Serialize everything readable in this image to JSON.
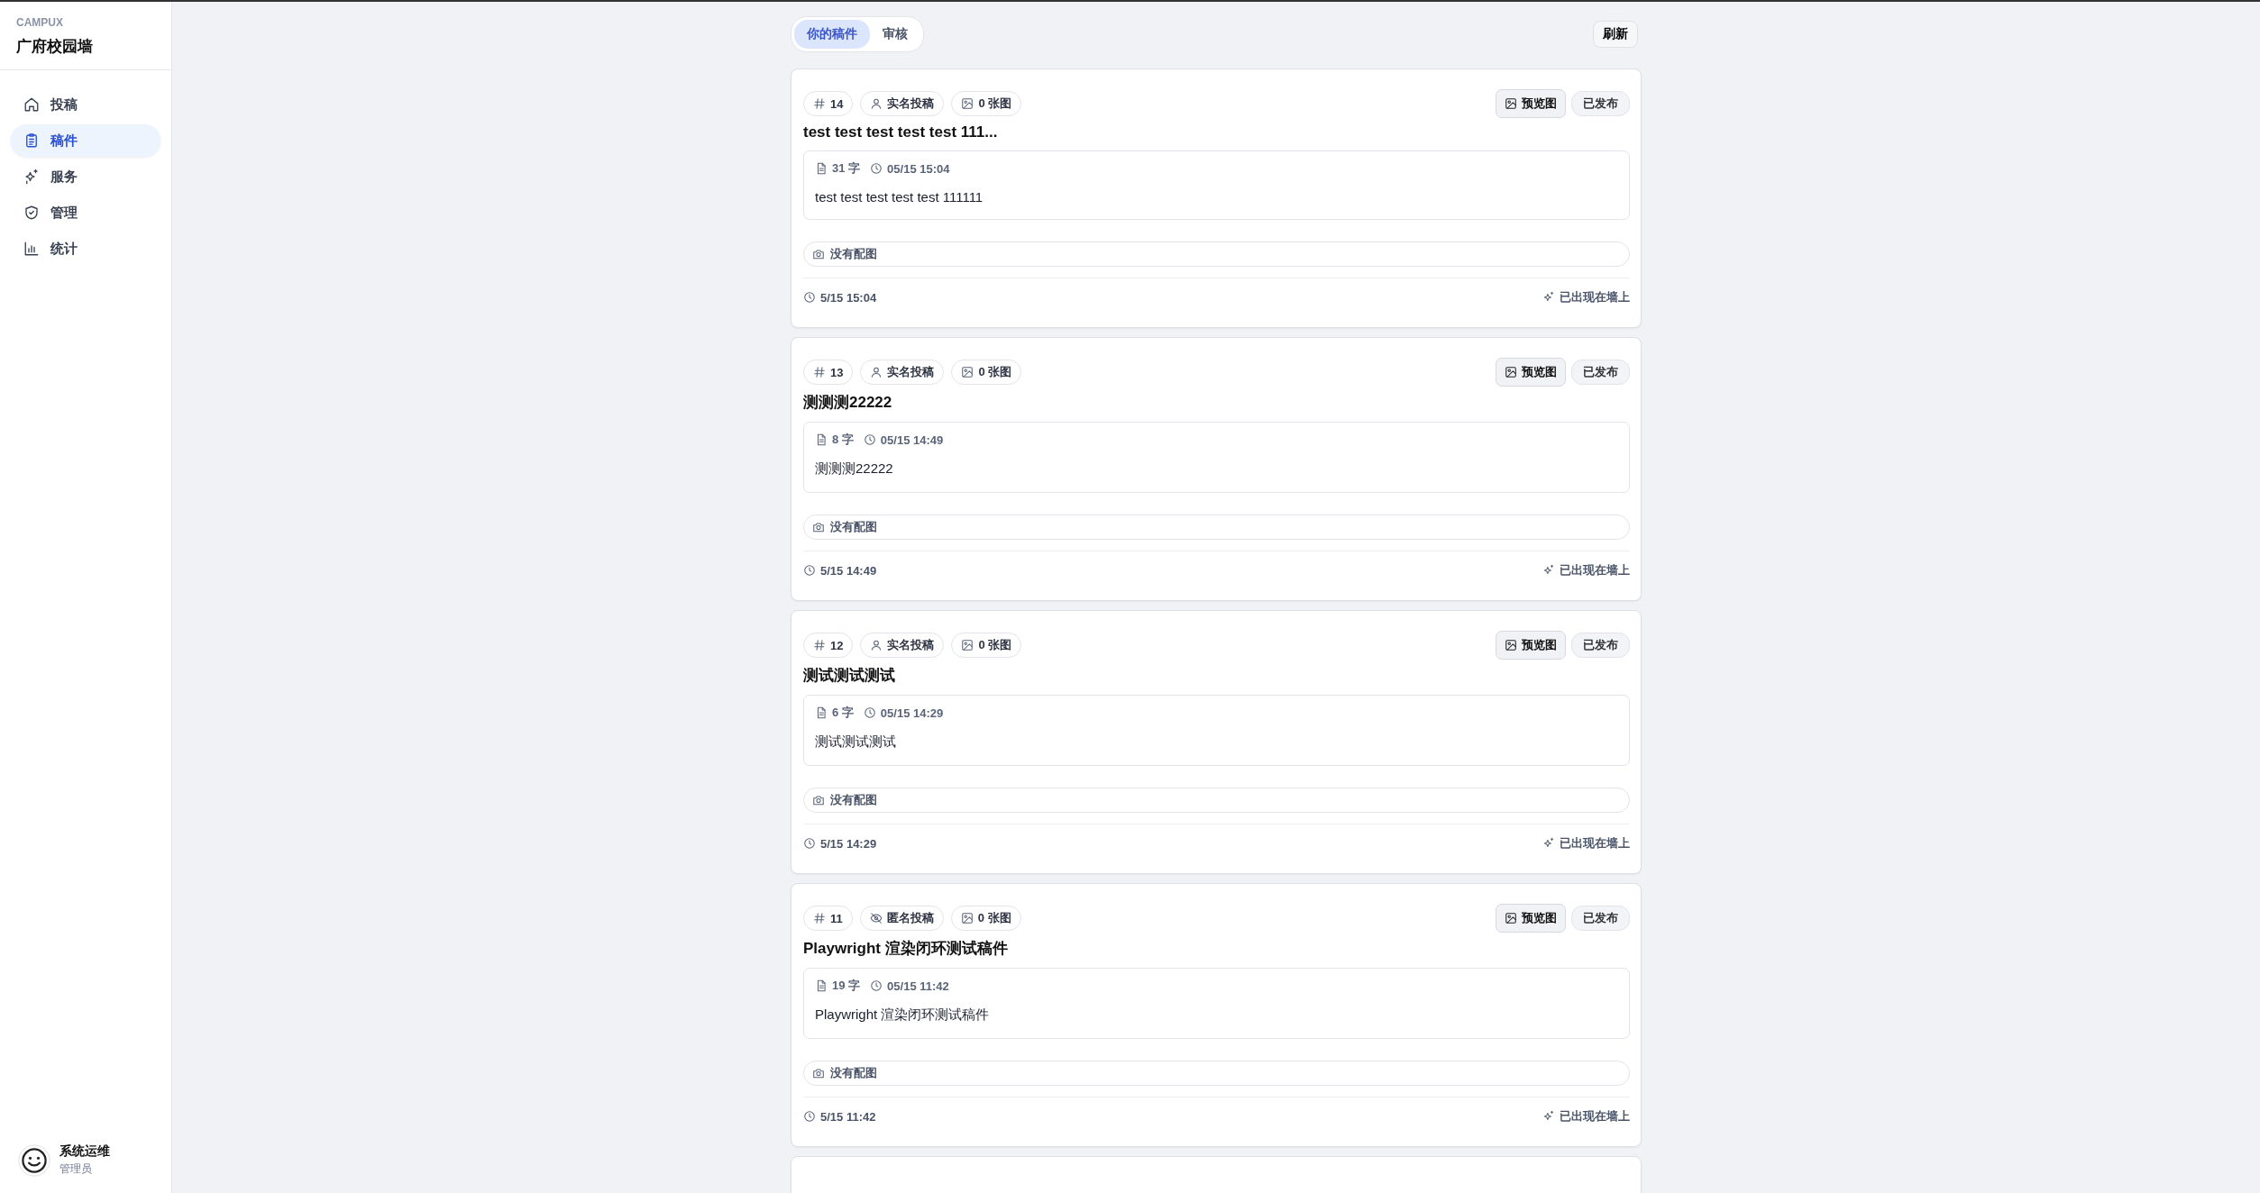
{
  "sidebar": {
    "brand": "CAMPUX",
    "title": "广府校园墙",
    "nav": [
      {
        "label": "投稿",
        "kind": "home",
        "selected": false
      },
      {
        "label": "稿件",
        "kind": "clipboard",
        "selected": true
      },
      {
        "label": "服务",
        "kind": "sparkles",
        "selected": false
      },
      {
        "label": "管理",
        "kind": "shield",
        "selected": false
      },
      {
        "label": "统计",
        "kind": "chart",
        "selected": false
      }
    ],
    "user": {
      "name": "系统运维",
      "role": "管理员"
    }
  },
  "tabs": [
    {
      "label": "你的稿件",
      "selected": true
    },
    {
      "label": "审核",
      "selected": false
    }
  ],
  "refresh_button": "刷新",
  "posts": [
    {
      "id": "14",
      "mode": {
        "kind": "real_name",
        "label": "实名投稿"
      },
      "images": "0 张图",
      "title": "test test test test test 111...",
      "preview": "预览图",
      "status": "已发布",
      "word_count": "31 字",
      "time": "05/15 15:04",
      "body": "test test test test test 111111",
      "no_image": "没有配图",
      "footer_time": "5/15 15:04",
      "wall_status": "已出现在墙上"
    },
    {
      "id": "13",
      "mode": {
        "kind": "real_name",
        "label": "实名投稿"
      },
      "images": "0 张图",
      "title": "测测测22222",
      "preview": "预览图",
      "status": "已发布",
      "word_count": "8 字",
      "time": "05/15 14:49",
      "body": "测测测22222",
      "no_image": "没有配图",
      "footer_time": "5/15 14:49",
      "wall_status": "已出现在墙上"
    },
    {
      "id": "12",
      "mode": {
        "kind": "real_name",
        "label": "实名投稿"
      },
      "images": "0 张图",
      "title": "测试测试测试",
      "preview": "预览图",
      "status": "已发布",
      "word_count": "6 字",
      "time": "05/15 14:29",
      "body": "测试测试测试",
      "no_image": "没有配图",
      "footer_time": "5/15 14:29",
      "wall_status": "已出现在墙上"
    },
    {
      "id": "11",
      "mode": {
        "kind": "anonymous",
        "label": "匿名投稿"
      },
      "images": "0 张图",
      "title": "Playwright 渲染闭环测试稿件",
      "preview": "预览图",
      "status": "已发布",
      "word_count": "19 字",
      "time": "05/15 11:42",
      "body": "Playwright 渲染闭环测试稿件",
      "no_image": "没有配图",
      "footer_time": "5/15 11:42",
      "wall_status": "已出现在墙上"
    }
  ]
}
